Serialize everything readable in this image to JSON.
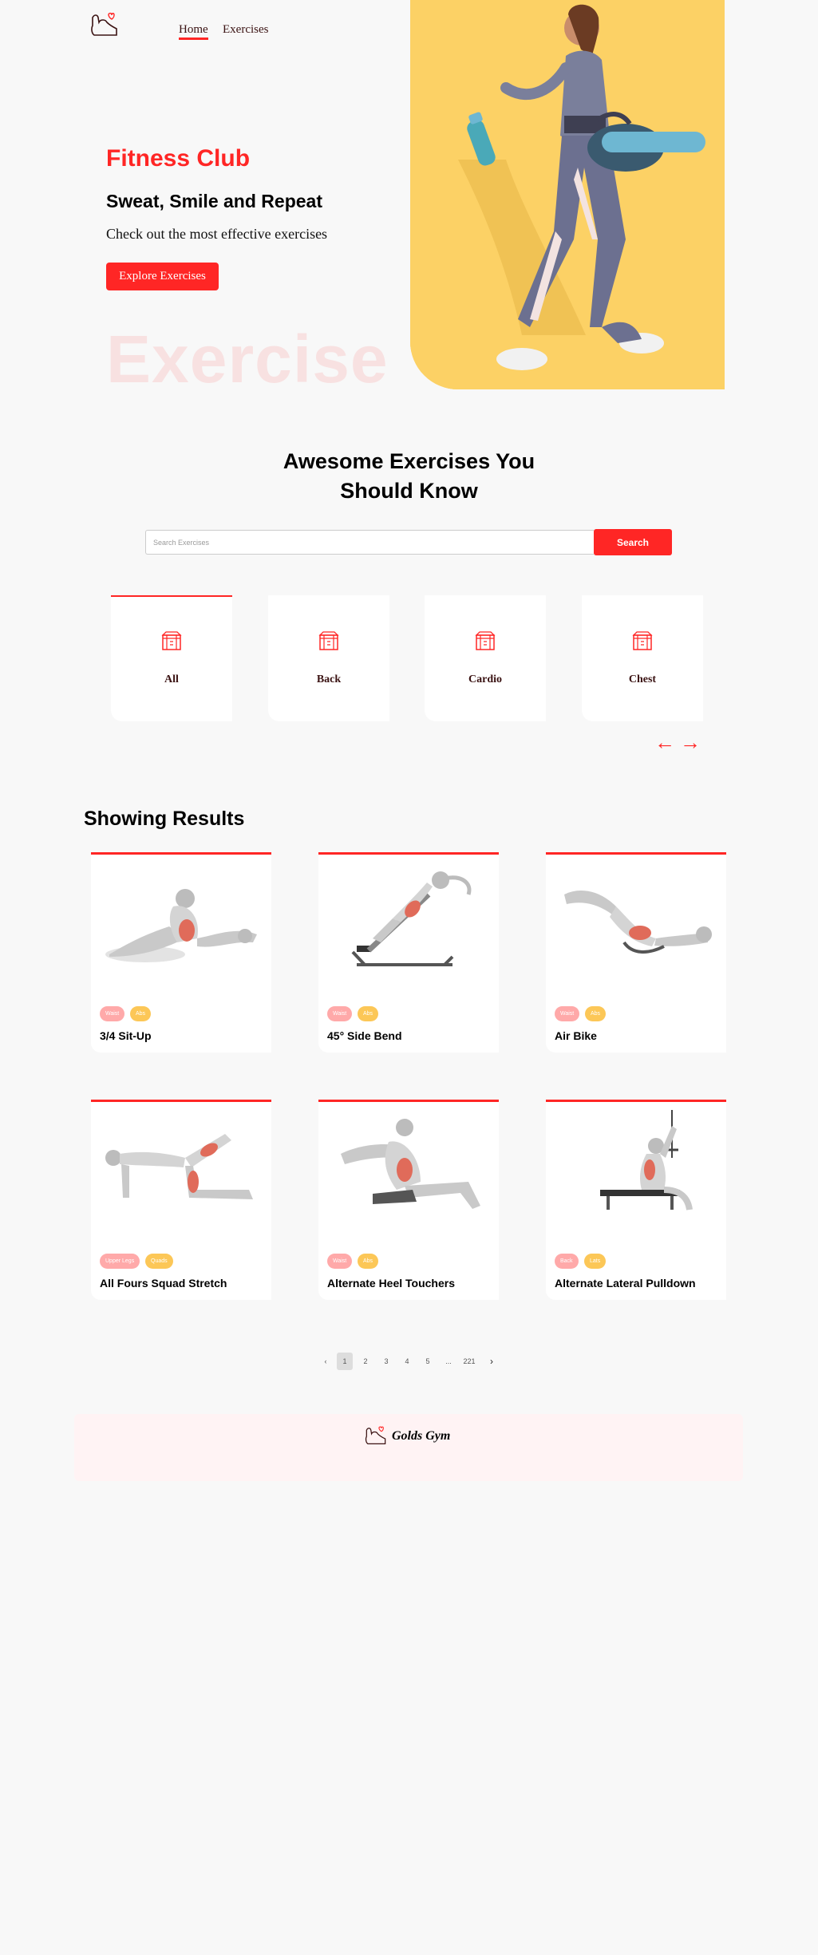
{
  "nav": {
    "home": "Home",
    "exercises": "Exercises"
  },
  "hero": {
    "title": "Fitness Club",
    "subtitle": "Sweat, Smile and Repeat",
    "description": "Check out the most effective exercises",
    "button": "Explore Exercises",
    "background_word": "Exercise"
  },
  "search": {
    "title_line1": "Awesome Exercises You",
    "title_line2": "Should Know",
    "placeholder": "Search Exercises",
    "button": "Search"
  },
  "categories": [
    {
      "label": "All",
      "active": true
    },
    {
      "label": "Back",
      "active": false
    },
    {
      "label": "Cardio",
      "active": false
    },
    {
      "label": "Chest",
      "active": false
    }
  ],
  "results": {
    "title": "Showing Results",
    "exercises": [
      {
        "name": "3/4 Sit-Up",
        "tags": [
          "Waist",
          "Abs"
        ]
      },
      {
        "name": "45° Side Bend",
        "tags": [
          "Waist",
          "Abs"
        ]
      },
      {
        "name": "Air Bike",
        "tags": [
          "Waist",
          "Abs"
        ]
      },
      {
        "name": "All Fours Squad Stretch",
        "tags": [
          "Upper Legs",
          "Quads"
        ]
      },
      {
        "name": "Alternate Heel Touchers",
        "tags": [
          "Waist",
          "Abs"
        ]
      },
      {
        "name": "Alternate Lateral Pulldown",
        "tags": [
          "Back",
          "Lats"
        ]
      }
    ]
  },
  "pagination": {
    "prev": "‹",
    "pages": [
      "1",
      "2",
      "3",
      "4",
      "5",
      "...",
      "221"
    ],
    "next": "›",
    "current": "1"
  },
  "footer": {
    "brand": "Golds Gym"
  },
  "colors": {
    "accent": "#ff2625",
    "tag_primary": "#ffa9a9",
    "tag_secondary": "#fcc757",
    "banner": "#fdd66e"
  }
}
